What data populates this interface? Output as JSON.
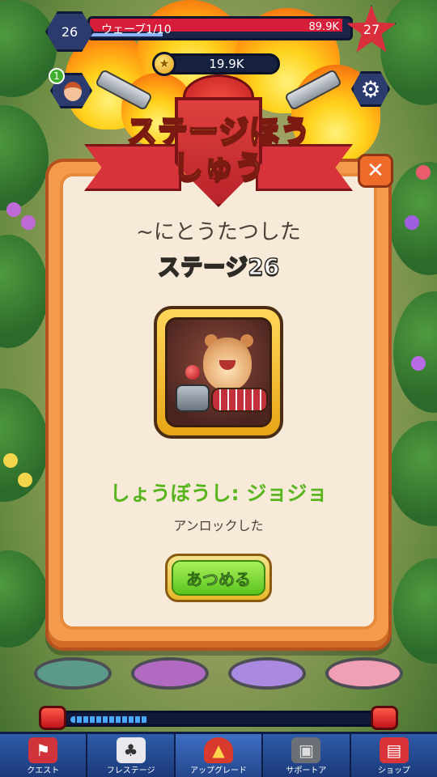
{
  "hud": {
    "player_level": "26",
    "wave_label": "ウェーブ1/10",
    "wave_hp": "89.9K",
    "stage_star": "27",
    "coins": "19.9K",
    "notification_count": "1",
    "settings_icon": "gear-icon",
    "wave_progress": 0.97
  },
  "dialog": {
    "title_line1": "ステージほう",
    "title_line2": "しゅう",
    "reached_label": "~にとうたつした",
    "stage_label": "ステージ26",
    "reward_name": "しょうぼうし: ジョジョ",
    "unlocked_label": "アンロックした",
    "collect_button": "あつめる",
    "close_icon": "close-icon"
  },
  "spawn_progress": 0.26,
  "nav": {
    "items": [
      {
        "label": "クエスト",
        "icon": "extinguisher-icon"
      },
      {
        "label": "フレステージ",
        "icon": "cards-icon"
      },
      {
        "label": "アップグレード",
        "icon": "helmet-icon"
      },
      {
        "label": "サポートア",
        "icon": "backpack-icon"
      },
      {
        "label": "ショップ",
        "icon": "shop-icon"
      }
    ]
  },
  "colors": {
    "accent_green": "#59b51e",
    "title_yellow": "#ffe53a",
    "dialog_orange": "#f39a4c",
    "nav_blue": "#2e5ba8"
  }
}
